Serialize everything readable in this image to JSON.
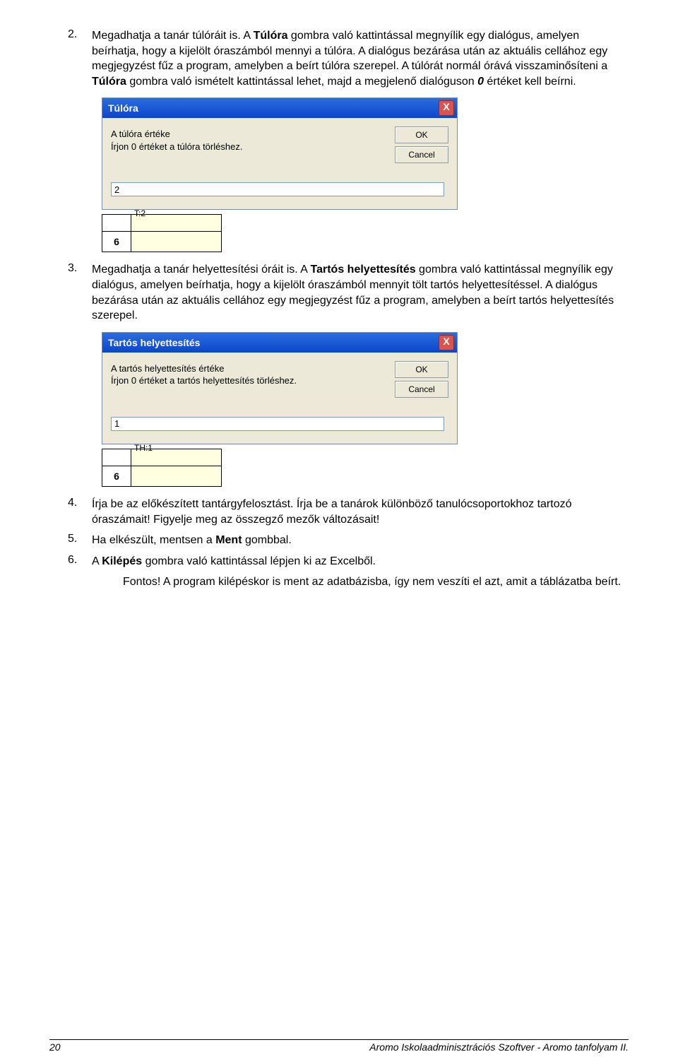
{
  "items": {
    "2": {
      "num": "2.",
      "text_a": "Megadhatja a tanár túlóráit is. A ",
      "bold_a": "Túlóra",
      "text_b": " gombra való kattintással megnyílik egy dialógus, amelyen beírhatja, hogy a kijelölt óraszámból mennyi a túlóra. A dialógus bezárása után az aktuális cellához egy megjegyzést fűz a program, amelyben a beírt túlóra szerepel. A túlórát normál órává visszaminősíteni a ",
      "bold_b": "Túlóra",
      "text_c": " gombra való ismételt kattintással lehet, majd a megjelenő dialóguson ",
      "ital_c": "0",
      "text_d": " értéket kell beírni."
    },
    "3": {
      "num": "3.",
      "text_a": "Megadhatja a tanár helyettesítési óráit is. A ",
      "bold_a": "Tartós helyettesítés",
      "text_b": " gombra való kattintással megnyílik egy dialógus, amelyen beírhatja, hogy a kijelölt óraszámból mennyit tölt tartós helyettesítéssel. A dialógus bezárása után az aktuális cellához egy megjegyzést fűz a program, amelyben a beírt tartós helyettesítés szerepel."
    },
    "4": {
      "num": "4.",
      "text": "Írja be az előkészített tantárgyfelosztást. Írja be a tanárok különböző tanulócsoportokhoz tartozó óraszámait! Figyelje meg az összegző mezők változásait!"
    },
    "5": {
      "num": "5.",
      "text_a": "Ha elkészült, mentsen a ",
      "bold_a": "Ment",
      "text_b": " gombbal."
    },
    "6": {
      "num": "6.",
      "text_a": "A ",
      "bold_a": "Kilépés",
      "text_b": " gombra való kattintással lépjen ki az Excelből."
    },
    "note": {
      "bold": "Fontos!",
      "text": " A program kilépéskor is ment az adatbázisba, így nem veszíti el azt, amit a táblázatba beírt."
    }
  },
  "dlg1": {
    "title": "Túlóra",
    "line1": "A túlóra értéke",
    "line2": "Írjon 0 értéket a túlóra törléshez.",
    "ok": "OK",
    "cancel": "Cancel",
    "value": "2",
    "close": "X"
  },
  "cell1": {
    "tag": "T:2",
    "num": "6"
  },
  "dlg2": {
    "title": "Tartós helyettesítés",
    "line1": "A tartós helyettesítés értéke",
    "line2": "Írjon 0 értéket a tartós helyettesítés törléshez.",
    "ok": "OK",
    "cancel": "Cancel",
    "value": "1",
    "close": "X"
  },
  "cell2": {
    "tag": "TH:1",
    "num": "6"
  },
  "footer": {
    "page": "20",
    "title": "Aromo Iskolaadminisztrációs Szoftver - Aromo tanfolyam II."
  }
}
